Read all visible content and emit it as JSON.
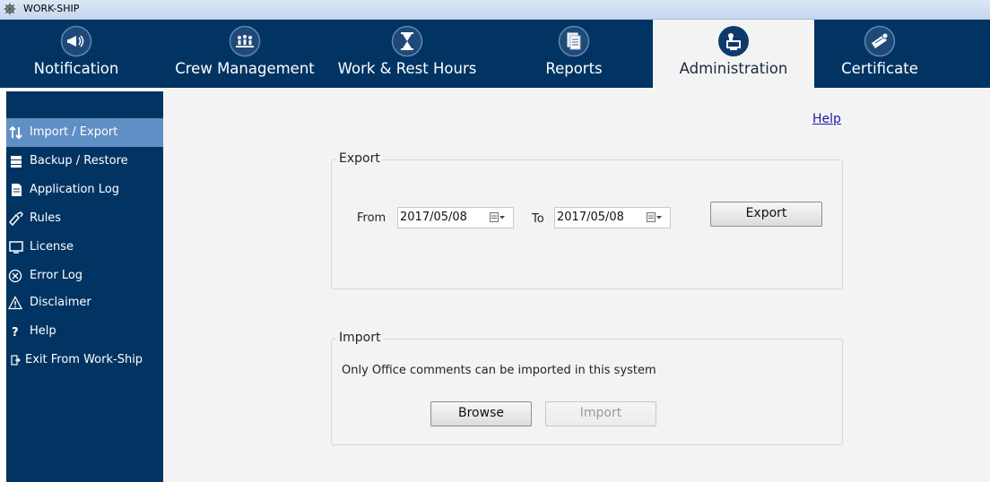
{
  "window": {
    "title": "WORK-SHIP"
  },
  "tabs": [
    {
      "label": "Notification",
      "icon": "megaphone-icon",
      "active": false
    },
    {
      "label": "Crew Management",
      "icon": "crew-icon",
      "active": false
    },
    {
      "label": "Work & Rest Hours",
      "icon": "hourglass-icon",
      "active": false
    },
    {
      "label": "Reports",
      "icon": "documents-icon",
      "active": false
    },
    {
      "label": "Administration",
      "icon": "admin-computer-icon",
      "active": true
    },
    {
      "label": "Certificate",
      "icon": "certificate-icon",
      "active": false
    }
  ],
  "sidebar": {
    "items": [
      {
        "label": "Import / Export",
        "icon": "up-down-arrows-icon",
        "active": true
      },
      {
        "label": "Backup / Restore",
        "icon": "database-icon"
      },
      {
        "label": "Application Log",
        "icon": "log-document-icon"
      },
      {
        "label": "Rules",
        "icon": "rules-icon"
      },
      {
        "label": "License",
        "icon": "monitor-icon"
      },
      {
        "label": "Error Log",
        "icon": "error-circle-icon"
      },
      {
        "label": "Disclaimer",
        "icon": "warning-triangle-icon"
      },
      {
        "label": "Help",
        "icon": "question-icon"
      },
      {
        "label": "Exit From Work-Ship",
        "icon": "exit-icon"
      }
    ]
  },
  "main": {
    "help_link": "Help",
    "export": {
      "title": "Export",
      "from_label": "From",
      "from_value": "2017/05/08",
      "to_label": "To",
      "to_value": "2017/05/08",
      "button": "Export"
    },
    "import": {
      "title": "Import",
      "note": "Only Office comments can be imported in this system",
      "browse_button": "Browse",
      "import_button": "Import",
      "import_enabled": false
    }
  },
  "colors": {
    "nav_bg": "#013463",
    "sidebar_active": "#5f8fc4",
    "content_bg": "#f3f3f3",
    "link": "#1a1aa6"
  }
}
